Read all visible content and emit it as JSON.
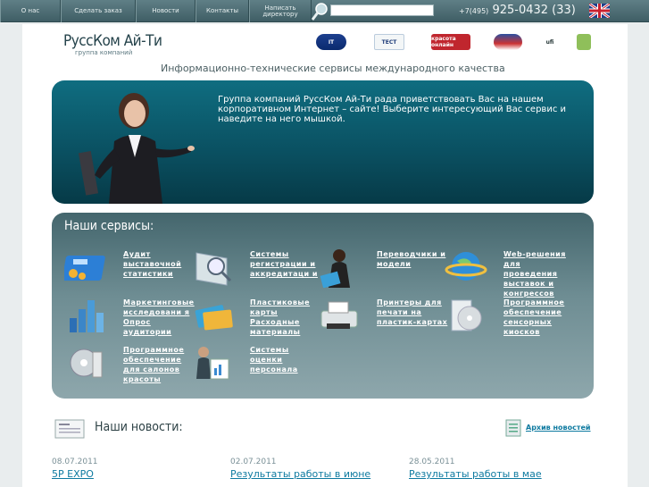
{
  "nav": {
    "items": [
      {
        "label": "О нас"
      },
      {
        "label": "Сделать заказ"
      },
      {
        "label": "Новости"
      },
      {
        "label": "Контакты"
      },
      {
        "label": "Написать директору"
      }
    ],
    "search_placeholder": "",
    "phone_prefix": "+7(495)",
    "phone_number": "925-0432 (33)",
    "language_icon": "uk-flag-icon"
  },
  "header": {
    "logo_title": "РуссКом Ай-Ти",
    "logo_subtitle": "группа компаний",
    "partners": [
      "IT",
      "ТЕСТ",
      "красота онлайн",
      "",
      "ufi",
      ""
    ],
    "tagline": "Информационно-технические сервисы международного качества"
  },
  "hero": {
    "text": "Группа компаний РуссКом Ай-Ти рада приветствовать Вас на нашем корпоративном Интернет – сайте! Выберите интересующий Вас сервис и наведите на него мышкой."
  },
  "services": {
    "title": "Наши сервисы:",
    "items": [
      {
        "label": "Аудит выставочной статистики",
        "icon": "calculator-icon"
      },
      {
        "label": "Системы регистрации и аккредитаци и",
        "icon": "scanner-icon"
      },
      {
        "label": "Переводчики и модели",
        "icon": "person-icon"
      },
      {
        "label": "Web-решения для проведения выставок и конгрессов",
        "icon": "globe-icon"
      },
      {
        "label": "Маркетинговые исследовани я Опрос аудитории",
        "icon": "bar-chart-icon"
      },
      {
        "label": "Пластиковые карты Расходные материалы",
        "icon": "cards-icon"
      },
      {
        "label": "Принтеры для печати на пластик-картах",
        "icon": "printer-icon"
      },
      {
        "label": "Программное обеспечение сенсорных киосков",
        "icon": "software-box-icon"
      },
      {
        "label": "Программное обеспечение для салонов красоты",
        "icon": "cd-icon"
      },
      {
        "label": "Системы оценки персонала",
        "icon": "staff-icon"
      }
    ]
  },
  "news": {
    "title": "Наши новости:",
    "archive_label": "Архив новостей",
    "items": [
      {
        "date": "08.07.2011",
        "title": "5P EXPO"
      },
      {
        "date": "02.07.2011",
        "title": "Результаты работы в июне"
      },
      {
        "date": "28.05.2011",
        "title": "Результаты работы в мае"
      }
    ]
  },
  "colors": {
    "nav_bg": "#4f6f76",
    "hero_bg": "#0a4f60",
    "services_bg": "#6e8d93",
    "link": "#0e7aa0"
  }
}
